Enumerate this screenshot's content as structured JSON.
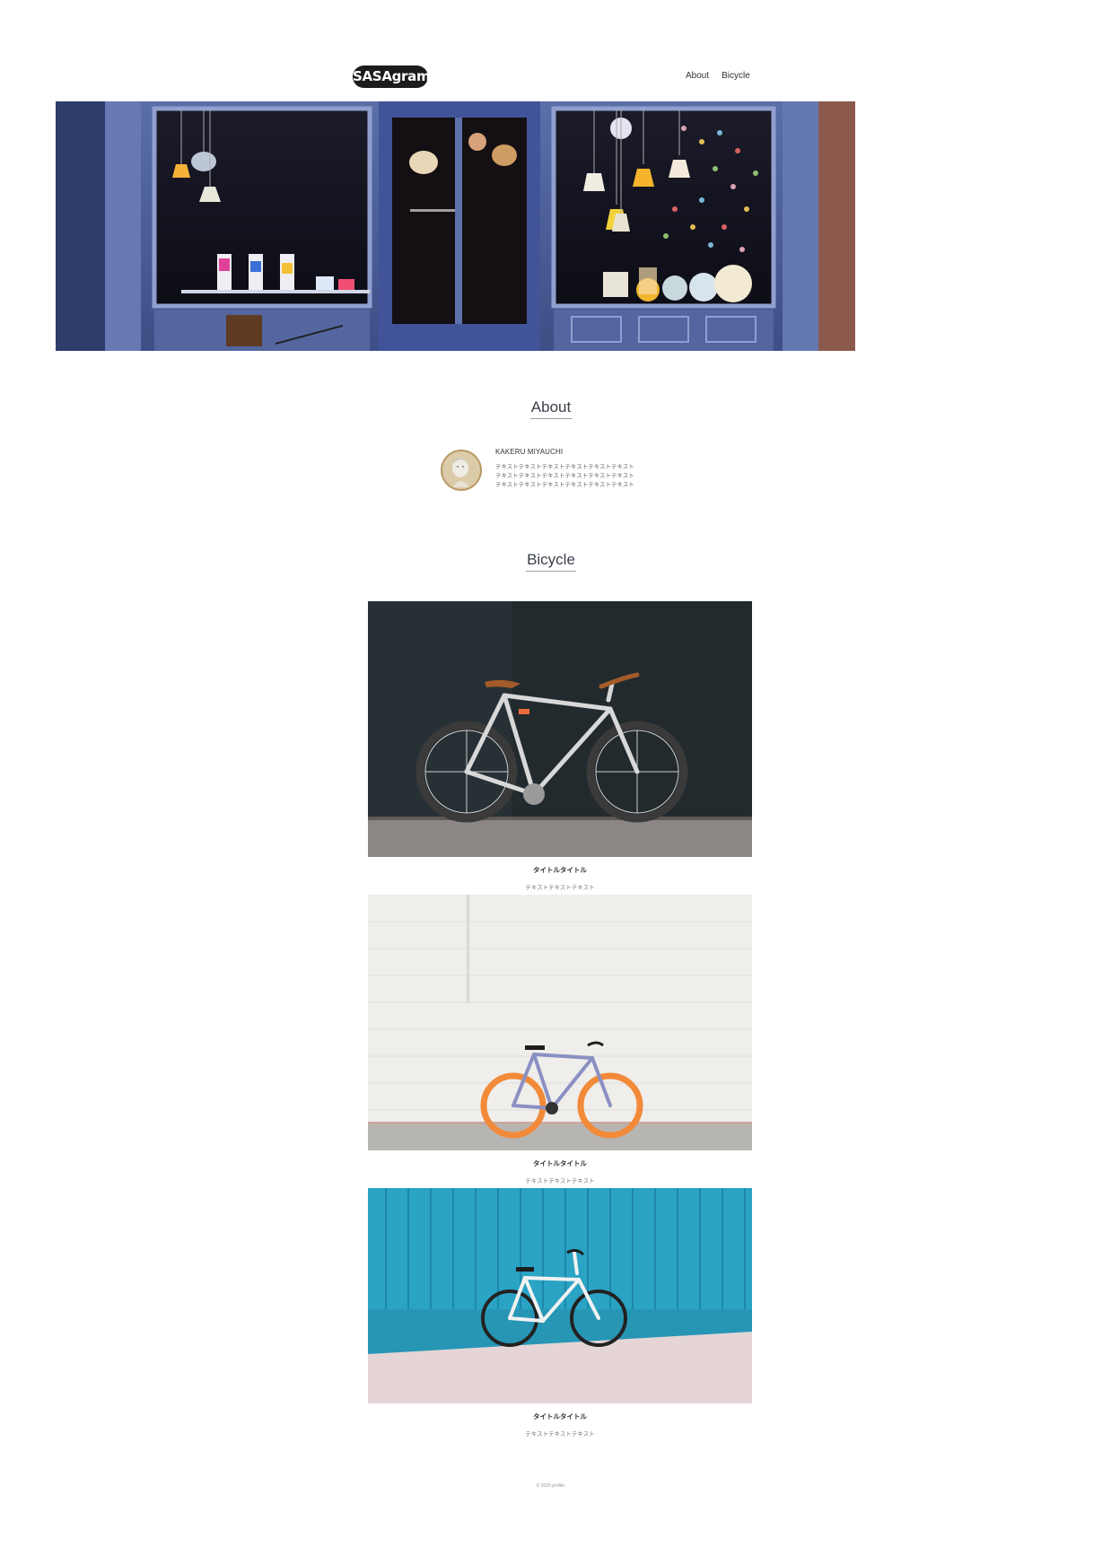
{
  "header": {
    "logo": "SASAgram",
    "nav": [
      {
        "label": "About"
      },
      {
        "label": "Bicycle"
      }
    ]
  },
  "about": {
    "heading": "About",
    "name": "KAKERU MIYAUCHI",
    "lines": [
      "テキストテキストテキストテキストテキストテキスト",
      "テキストテキストテキストテキストテキストテキスト",
      "テキストテキストテキストテキストテキストテキスト"
    ]
  },
  "bicycle": {
    "heading": "Bicycle",
    "cards": [
      {
        "title": "タイトルタイトル",
        "text": "テキストテキストテキスト"
      },
      {
        "title": "タイトルタイトル",
        "text": "テキストテキストテキスト"
      },
      {
        "title": "タイトルタイトル",
        "text": "テキストテキストテキスト"
      }
    ]
  },
  "footer": {
    "copyright": "© 2020 profile."
  }
}
